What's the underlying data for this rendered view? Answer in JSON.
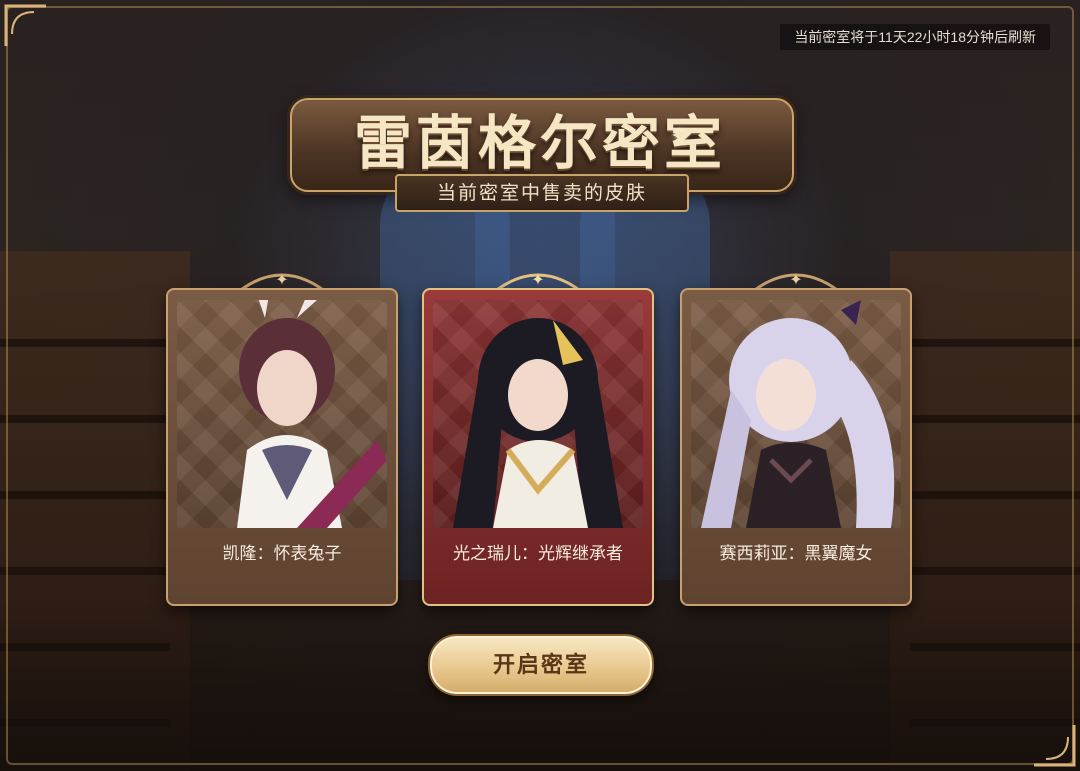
{
  "header": {
    "refresh_timer": "当前密室将于11天22小时18分钟后刷新"
  },
  "title": {
    "main": "雷茵格尔密室",
    "subtitle": "当前密室中售卖的皮肤"
  },
  "cards": [
    {
      "name": "凯隆：怀表兔子",
      "hair": "#5b2f38",
      "outfit": "#8a2a55",
      "highlighted": false
    },
    {
      "name": "光之瑞儿：光辉继承者",
      "hair": "#1c1a22",
      "outfit": "#f2ede3",
      "highlighted": true
    },
    {
      "name": "赛西莉亚：黑翼魔女",
      "hair": "#d8d2ea",
      "outfit": "#2a2026",
      "highlighted": false
    }
  ],
  "actions": {
    "open_label": "开启密室"
  },
  "colors": {
    "gold": "#c9a36a",
    "card_brown": "#7a5b44",
    "card_red": "#9a3a3a",
    "button_gold": "#e9c98f"
  }
}
